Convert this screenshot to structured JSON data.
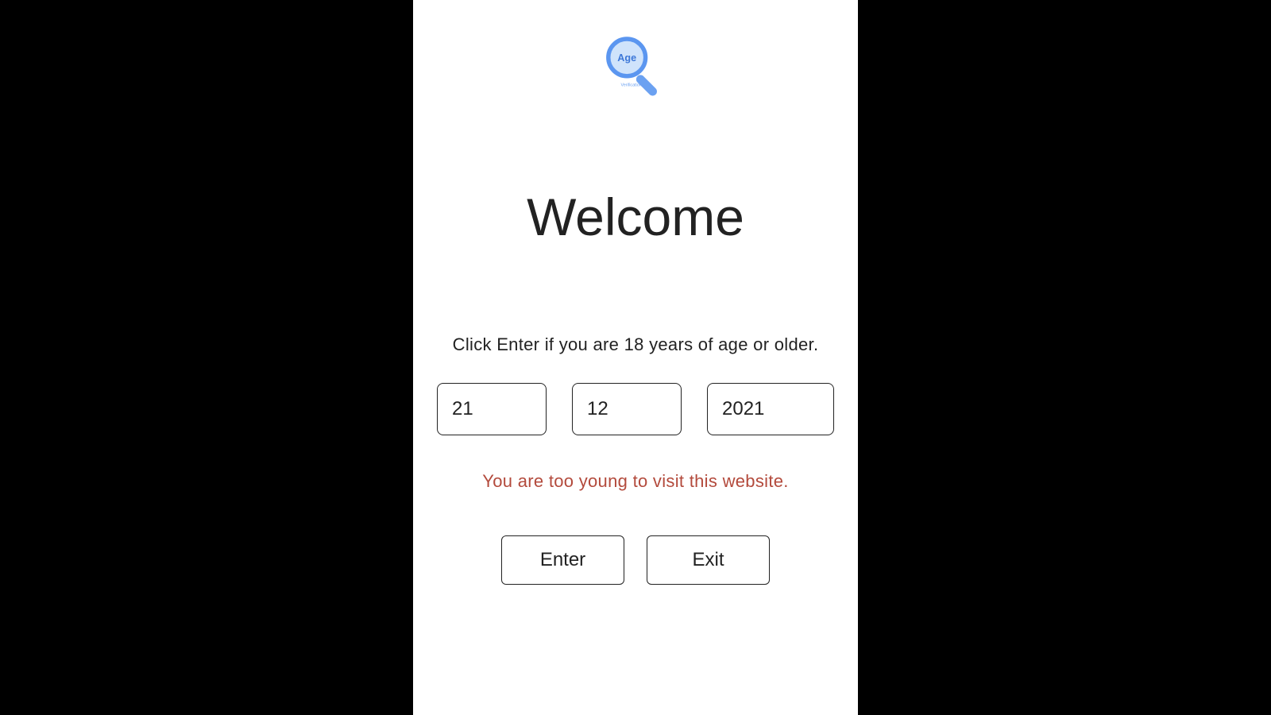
{
  "logo": {
    "circle_text": "Age",
    "sub_text": "Verification"
  },
  "heading": "Welcome",
  "instruction": "Click Enter if you are 18 years of age or older.",
  "fields": {
    "day": "21",
    "month": "12",
    "year": "2021"
  },
  "error_message": "You are too young to visit this website.",
  "buttons": {
    "enter": "Enter",
    "exit": "Exit"
  }
}
